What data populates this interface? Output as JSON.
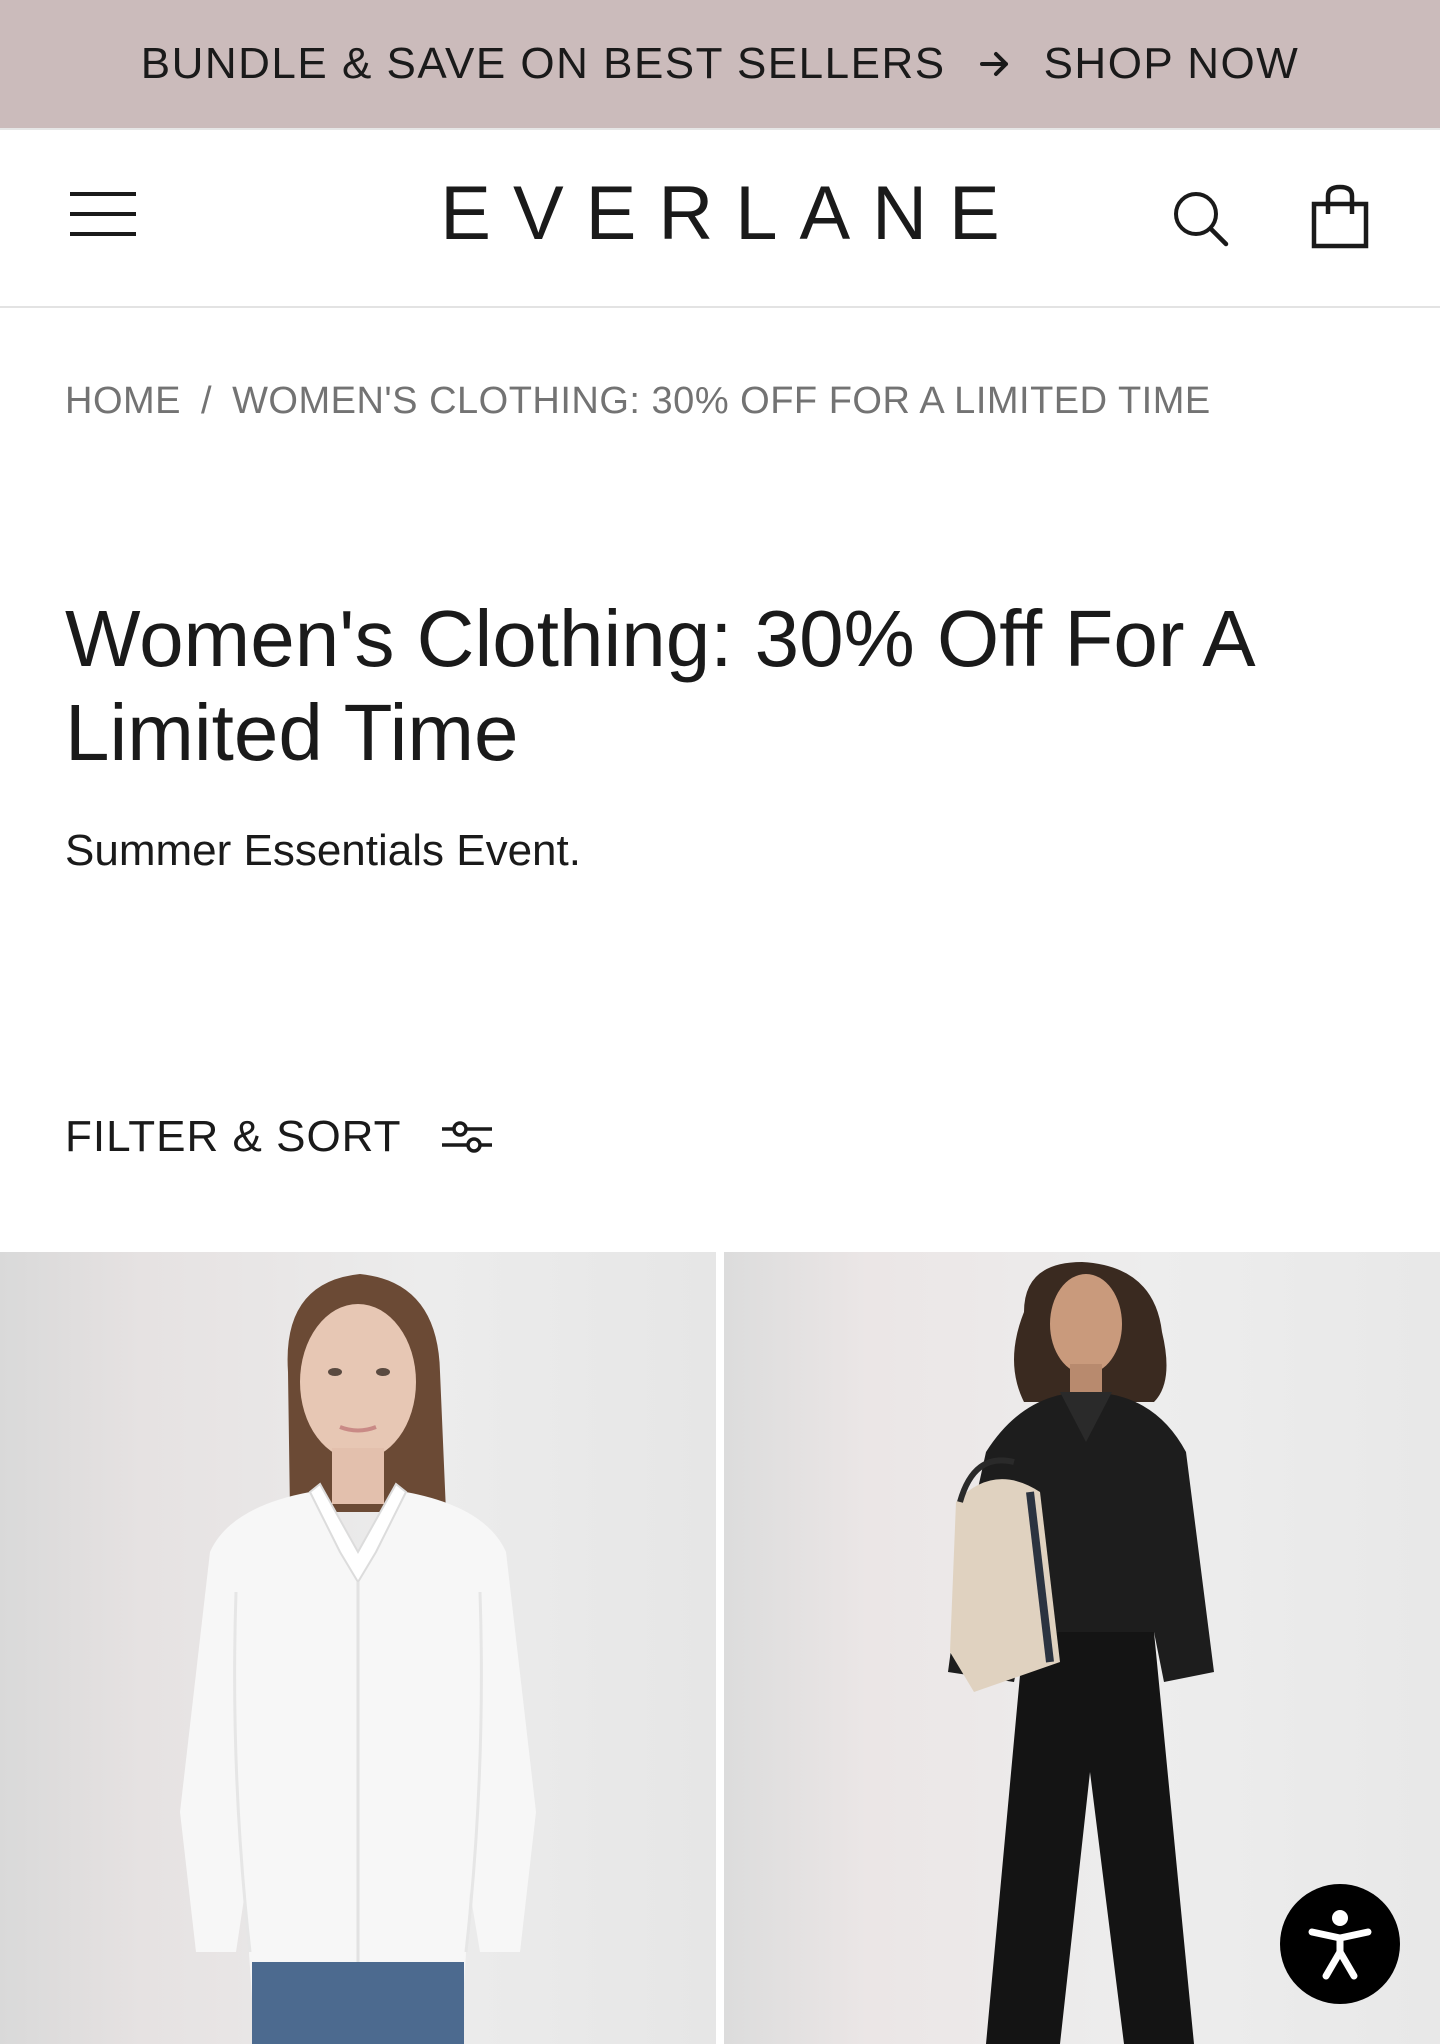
{
  "promo": {
    "text": "BUNDLE & SAVE ON BEST SELLERS",
    "cta": "SHOP NOW"
  },
  "header": {
    "logo": "EVERLANE",
    "icons": [
      "menu-icon",
      "search-icon",
      "shopping-bag-icon"
    ]
  },
  "breadcrumb": {
    "home": "HOME",
    "separator": "/",
    "current": "WOMEN'S CLOTHING: 30% OFF FOR A LIMITED TIME"
  },
  "page": {
    "title": "Women's Clothing: 30% Off For A Limited Time",
    "subtitle": "Summer Essentials Event."
  },
  "filter": {
    "label": "FILTER & SORT",
    "icon": "sliders-icon"
  },
  "products": [
    {
      "image": "model-in-white-button-up-shirt-and-jeans"
    },
    {
      "image": "model-in-black-top-and-wide-leg-pants-holding-tote-bag"
    }
  ],
  "accessibility": {
    "icon": "accessibility-person-icon"
  },
  "colors": {
    "promo_bg": "#cbbbbb",
    "text": "#1a1a1a",
    "muted": "#737373",
    "divider": "#e3e3e3"
  }
}
